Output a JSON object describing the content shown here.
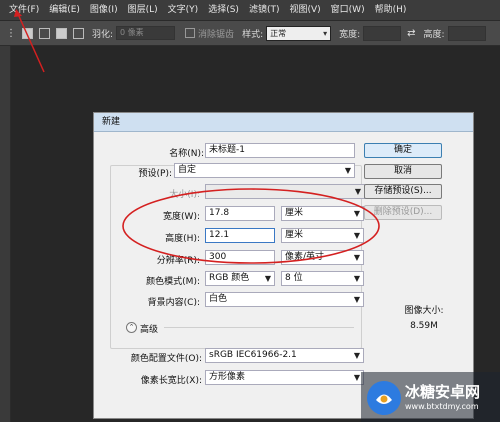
{
  "menu": [
    "文件(F)",
    "编辑(E)",
    "图像(I)",
    "图层(L)",
    "文字(Y)",
    "选择(S)",
    "滤镜(T)",
    "视图(V)",
    "窗口(W)",
    "帮助(H)"
  ],
  "options_bar": {
    "feather_label": "羽化:",
    "feather_value": "0 像素",
    "antialias_label": "消除锯齿",
    "style_label": "样式:",
    "style_value": "正常",
    "width_label": "宽度:",
    "height_label": "高度:"
  },
  "dialog": {
    "title": "新建",
    "name_label": "名称(N):",
    "name_value": "未标题-1",
    "preset_label": "预设(P):",
    "preset_value": "自定",
    "size_label": "大小(I):",
    "width_label": "宽度(W):",
    "width_value": "17.8",
    "width_unit": "厘米",
    "height_label": "高度(H):",
    "height_value": "12.1",
    "height_unit": "厘米",
    "resolution_label": "分辨率(R):",
    "resolution_value": "300",
    "resolution_unit": "像素/英寸",
    "colormode_label": "颜色模式(M):",
    "colormode_value": "RGB 颜色",
    "bitdepth_value": "8 位",
    "background_label": "背景内容(C):",
    "background_value": "白色",
    "advanced_label": "高级",
    "colorprofile_label": "颜色配置文件(O):",
    "colorprofile_value": "sRGB IEC61966-2.1",
    "pixelaspect_label": "像素长宽比(X):",
    "pixelaspect_value": "方形像素",
    "ok_button": "确定",
    "cancel_button": "取消",
    "save_preset_button": "存储预设(S)...",
    "delete_preset_button": "删除预设(D)...",
    "image_size_label": "图像大小:",
    "image_size_value": "8.59M"
  },
  "watermark": {
    "title": "冰糖安卓网",
    "url": "www.btxtdmy.com"
  },
  "colors": {
    "annotation_red": "#d42020",
    "dialog_title_bg": "#cfe0f1"
  }
}
